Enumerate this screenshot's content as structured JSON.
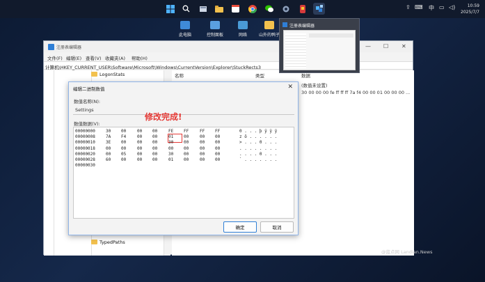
{
  "taskbar": {
    "clock_time": "10:59",
    "clock_date": "2025/7/7",
    "ime": "中"
  },
  "desktop_icons": [
    {
      "label": "此电脑"
    },
    {
      "label": "控制面板"
    },
    {
      "label": "网络"
    },
    {
      "label": "山外的鸭子"
    }
  ],
  "thumbnail": {
    "title": "注册表编辑器"
  },
  "regedit": {
    "title": "注册表编辑器",
    "menu": [
      "文件(F)",
      "编辑(E)",
      "查看(V)",
      "收藏夹(A)",
      "帮助(H)"
    ],
    "address": "计算机\\HKEY_CURRENT_USER\\Software\\Microsoft\\Windows\\CurrentVersion\\Explorer\\StuckRects3",
    "tree_top": "LogonStats",
    "tree_bottom": "TypedPaths",
    "col_name": "名称",
    "col_type": "类型",
    "col_data": "数据",
    "default_value": "(数值未设置)",
    "binary_value": "30 00 00 00 fe ff ff ff 7a f4 00 00 01 00 00 00 ..."
  },
  "dialog": {
    "title": "编辑二进制数值",
    "name_label": "数值名称(N):",
    "value_name": "Settings",
    "data_label": "数值数据(V):",
    "rows": [
      {
        "addr": "00000000",
        "bytes": [
          "30",
          "00",
          "00",
          "00",
          "FE",
          "FF",
          "FF",
          "FF"
        ],
        "ascii": "0 . . . þ ÿ ÿ ÿ"
      },
      {
        "addr": "00000008",
        "bytes": [
          "7A",
          "F4",
          "00",
          "00",
          "01",
          "00",
          "00",
          "00"
        ],
        "ascii": "z ô . . . . . ."
      },
      {
        "addr": "00000010",
        "bytes": [
          "3E",
          "00",
          "00",
          "00",
          "30",
          "00",
          "00",
          "00"
        ],
        "ascii": "> . . . 0 . . ."
      },
      {
        "addr": "00000018",
        "bytes": [
          "00",
          "00",
          "00",
          "00",
          "00",
          "00",
          "00",
          "00"
        ],
        "ascii": ". . . . . . . ."
      },
      {
        "addr": "00000020",
        "bytes": [
          "00",
          "05",
          "00",
          "00",
          "30",
          "00",
          "00",
          "00"
        ],
        "ascii": ". . . . 0 . . ."
      },
      {
        "addr": "00000028",
        "bytes": [
          "60",
          "00",
          "00",
          "00",
          "01",
          "00",
          "00",
          "00"
        ],
        "ascii": "` . . . . . . ."
      },
      {
        "addr": "00000030",
        "bytes": [],
        "ascii": ""
      }
    ],
    "ok_label": "确定",
    "cancel_label": "取消"
  },
  "annotation": "修改完成!",
  "watermark": "@蓝点网 Landian.News",
  "colors": {
    "annotation": "#e53935",
    "accent": "#2f7fd6",
    "folder": "#f2c14e"
  }
}
